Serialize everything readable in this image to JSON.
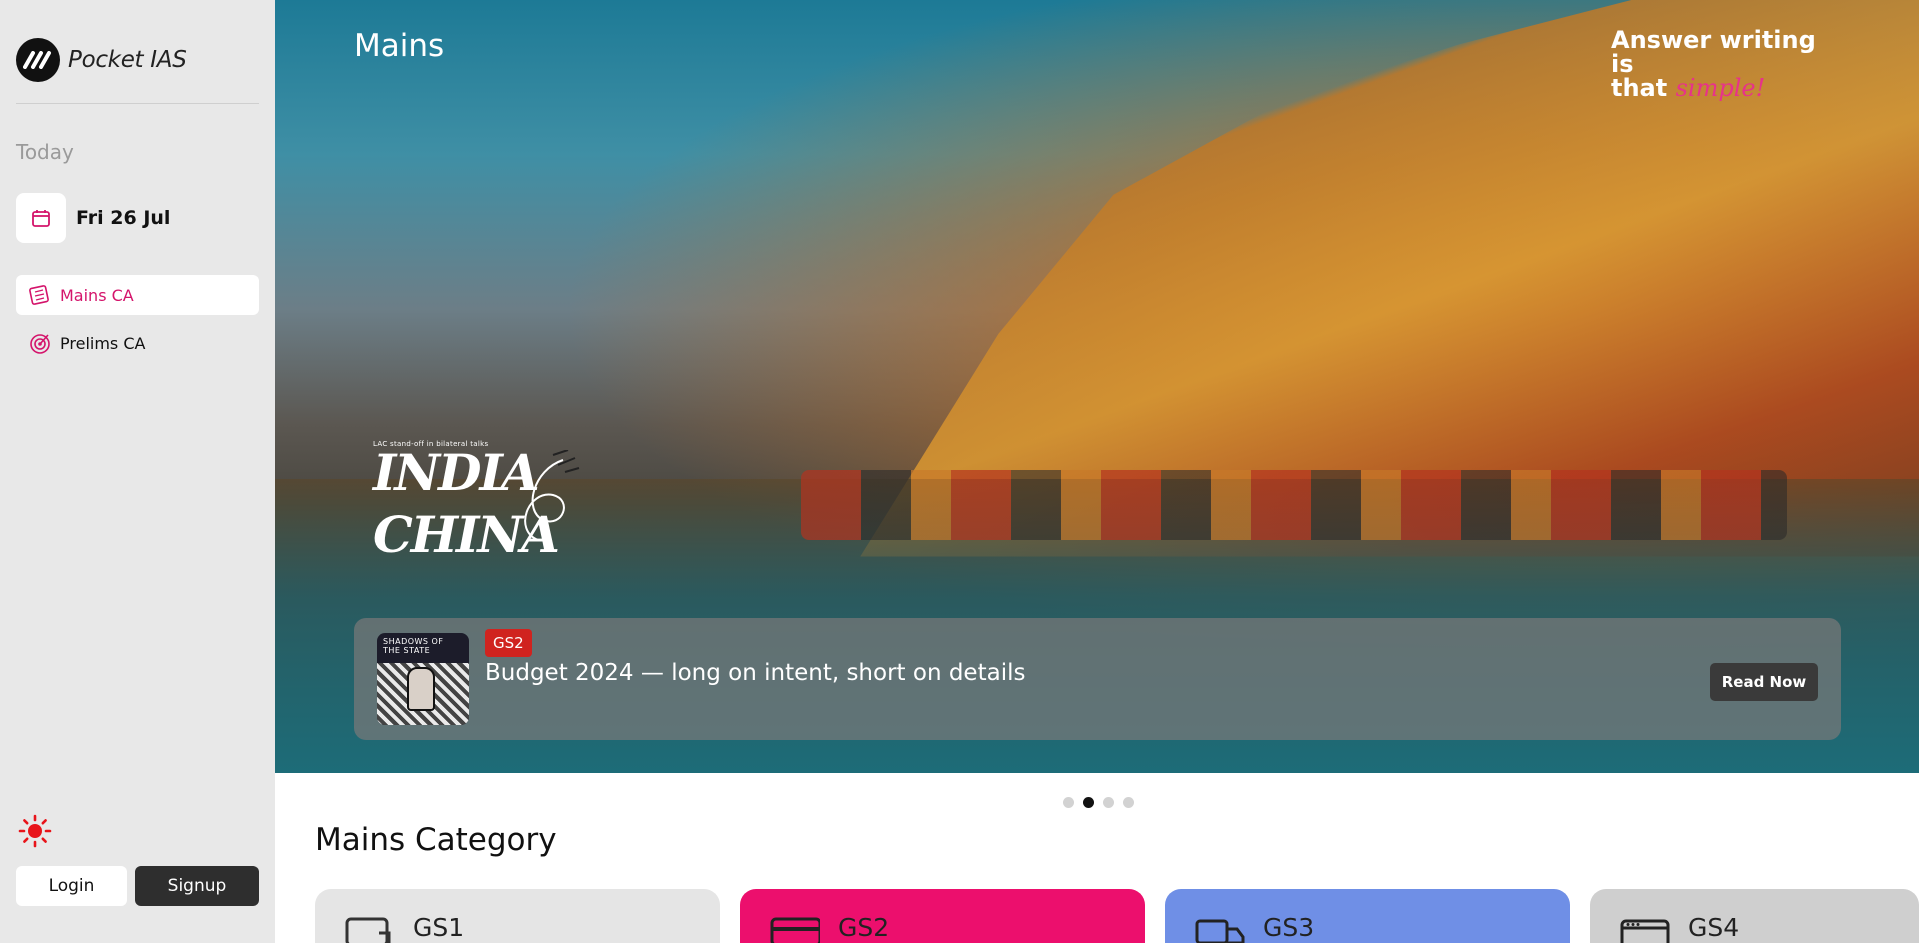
{
  "brand": {
    "name": "Pocket IAS"
  },
  "sidebar": {
    "today_label": "Today",
    "date": "Fri 26 Jul",
    "nav": [
      {
        "label": "Mains CA",
        "active": true,
        "icon": "newspaper-icon"
      },
      {
        "label": "Prelims CA",
        "active": false,
        "icon": "target-icon"
      }
    ],
    "theme_icon": "sun-icon",
    "login_label": "Login",
    "signup_label": "Signup"
  },
  "hero": {
    "title": "Mains",
    "tagline_line1": "Answer writing is",
    "tagline_that": "that",
    "tagline_accent": "simple!",
    "feature_sub": "LAC stand-off in bilateral talks",
    "feature_word1": "INDIA",
    "feature_word2": "CHINA",
    "article": {
      "thumb_title": "SHADOWS OF THE STATE",
      "badge": "GS2",
      "headline": "Budget 2024 — long on intent, short on details",
      "cta": "Read Now"
    },
    "carousel_active": 2,
    "carousel_total": 4
  },
  "section": {
    "title": "Mains Category",
    "categories": [
      {
        "label": "GS1",
        "color": "#e5e5e5",
        "icon": "monitor-icon"
      },
      {
        "label": "GS2",
        "color": "#ec0f6d",
        "icon": "card-icon"
      },
      {
        "label": "GS3",
        "color": "#6f8fe6",
        "icon": "truck-icon"
      },
      {
        "label": "GS4",
        "color": "#cfcfcf",
        "icon": "browser-window-icon"
      }
    ]
  },
  "colors": {
    "accent": "#d4146b",
    "badge": "#d0231f"
  }
}
